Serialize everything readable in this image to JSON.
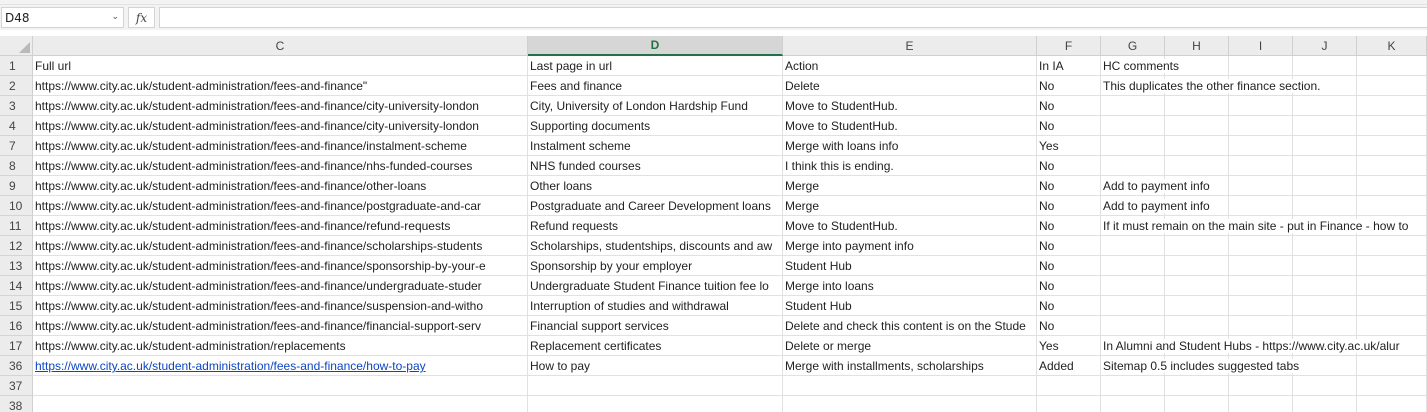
{
  "formula_bar": {
    "name_box": "D48",
    "fx_label": "fx",
    "formula": ""
  },
  "columns": [
    "C",
    "D",
    "E",
    "F",
    "G",
    "H",
    "I",
    "J",
    "K"
  ],
  "selected_column": "D",
  "rows": [
    {
      "num": "1",
      "C": "Full url",
      "D": "Last page in url",
      "E": "Action",
      "F": "In IA",
      "G": "HC comments"
    },
    {
      "num": "2",
      "C": "https://www.city.ac.uk/student-administration/fees-and-finance\"",
      "D": "Fees and finance",
      "E": "Delete",
      "F": "No",
      "G": "This duplicates the other finance section."
    },
    {
      "num": "3",
      "C": "https://www.city.ac.uk/student-administration/fees-and-finance/city-university-london",
      "D": "City, University of London Hardship Fund",
      "E": "Move to StudentHub.",
      "F": "No",
      "G": ""
    },
    {
      "num": "4",
      "C": "https://www.city.ac.uk/student-administration/fees-and-finance/city-university-london",
      "D": "Supporting documents",
      "E": "Move to StudentHub.",
      "F": "No",
      "G": ""
    },
    {
      "num": "7",
      "C": "https://www.city.ac.uk/student-administration/fees-and-finance/instalment-scheme",
      "D": "Instalment scheme",
      "E": "Merge with loans info",
      "F": "Yes",
      "G": ""
    },
    {
      "num": "8",
      "C": "https://www.city.ac.uk/student-administration/fees-and-finance/nhs-funded-courses",
      "D": "NHS funded courses",
      "E": "I think this is ending.",
      "F": "No",
      "G": ""
    },
    {
      "num": "9",
      "C": "https://www.city.ac.uk/student-administration/fees-and-finance/other-loans",
      "D": "Other loans",
      "E": "Merge",
      "F": "No",
      "G": "Add to payment info"
    },
    {
      "num": "10",
      "C": "https://www.city.ac.uk/student-administration/fees-and-finance/postgraduate-and-car",
      "D": "Postgraduate and Career Development loans",
      "E": "Merge",
      "F": "No",
      "G": "Add to payment info"
    },
    {
      "num": "11",
      "C": "https://www.city.ac.uk/student-administration/fees-and-finance/refund-requests",
      "D": "Refund requests",
      "E": "Move to StudentHub.",
      "F": "No",
      "G": "If it must remain on the main site - put in Finance - how to"
    },
    {
      "num": "12",
      "C": "https://www.city.ac.uk/student-administration/fees-and-finance/scholarships-students",
      "D": "Scholarships, studentships, discounts and aw",
      "E": "Merge into payment info",
      "F": "No",
      "G": ""
    },
    {
      "num": "13",
      "C": "https://www.city.ac.uk/student-administration/fees-and-finance/sponsorship-by-your-e",
      "D": "Sponsorship by your employer",
      "E": "Student Hub",
      "F": "No",
      "G": ""
    },
    {
      "num": "14",
      "C": "https://www.city.ac.uk/student-administration/fees-and-finance/undergraduate-studer",
      "D": "Undergraduate Student Finance tuition fee lo",
      "E": "Merge into loans",
      "F": "No",
      "G": ""
    },
    {
      "num": "15",
      "C": "https://www.city.ac.uk/student-administration/fees-and-finance/suspension-and-witho",
      "D": "Interruption of studies and withdrawal",
      "E": "Student Hub",
      "F": "No",
      "G": ""
    },
    {
      "num": "16",
      "C": "https://www.city.ac.uk/student-administration/fees-and-finance/financial-support-serv",
      "D": "Financial support services",
      "E": "Delete and check this content is on the Stude",
      "F": "No",
      "G": ""
    },
    {
      "num": "17",
      "C": "https://www.city.ac.uk/student-administration/replacements",
      "D": "Replacement certificates",
      "E": "Delete or merge",
      "F": "Yes",
      "G": "In Alumni and Student Hubs - https://www.city.ac.uk/alur"
    },
    {
      "num": "36",
      "C": "https://www.city.ac.uk/student-administration/fees-and-finance/how-to-pay",
      "C_link": true,
      "D": "How to pay",
      "E": "Merge with installments, scholarships",
      "F": "Added",
      "G": "Sitemap 0.5 includes suggested tabs"
    },
    {
      "num": "37",
      "C": "",
      "D": "",
      "E": "",
      "F": "",
      "G": ""
    },
    {
      "num": "38",
      "C": "",
      "D": "",
      "E": "",
      "F": "",
      "G": ""
    }
  ],
  "colors": {
    "selected_header_accent": "#217346",
    "hyperlink": "#0b47c1"
  }
}
